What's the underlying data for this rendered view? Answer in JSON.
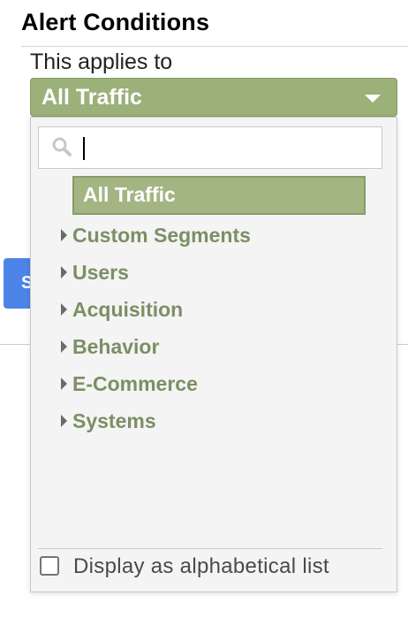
{
  "section": {
    "title": "Alert Conditions",
    "applies_label": "This applies to"
  },
  "select": {
    "current_value": "All Traffic",
    "accent_color": "#9cb07a"
  },
  "dropdown": {
    "search_value": "",
    "selected_option": "All Traffic",
    "categories": [
      {
        "label": "Custom Segments"
      },
      {
        "label": "Users"
      },
      {
        "label": "Acquisition"
      },
      {
        "label": "Behavior"
      },
      {
        "label": "E-Commerce"
      },
      {
        "label": "Systems"
      }
    ],
    "alphabetical_label": "Display as alphabetical list",
    "alphabetical_checked": false
  },
  "background_button": {
    "label": "S",
    "color": "#4c84e8"
  },
  "icons": {
    "search": "search-icon",
    "dropdown_caret": "chevron-down-icon",
    "expand": "caret-right-icon"
  }
}
